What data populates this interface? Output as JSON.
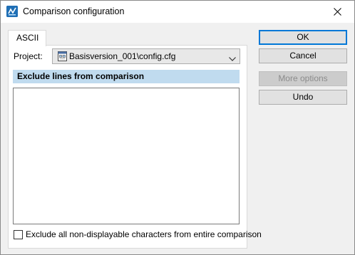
{
  "window": {
    "title": "Comparison configuration",
    "icon": "app-icon",
    "close_icon": "close-icon"
  },
  "tabs": [
    {
      "label": "ASCII",
      "selected": true
    }
  ],
  "project": {
    "label": "Project:",
    "value": "Basisversion_001\\config.cfg",
    "icon": "config-file-icon"
  },
  "exclude_section": {
    "header": "Exclude lines from comparison",
    "header_color": "#c0dbef",
    "items": []
  },
  "exclude_non_displayable": {
    "label": "Exclude all non-displayable characters from entire comparison",
    "checked": false
  },
  "buttons": {
    "ok": "OK",
    "cancel": "Cancel",
    "more_options": "More options",
    "undo": "Undo"
  },
  "colors": {
    "accent": "#0078d7",
    "dialog_bg": "#f0f0f0"
  }
}
